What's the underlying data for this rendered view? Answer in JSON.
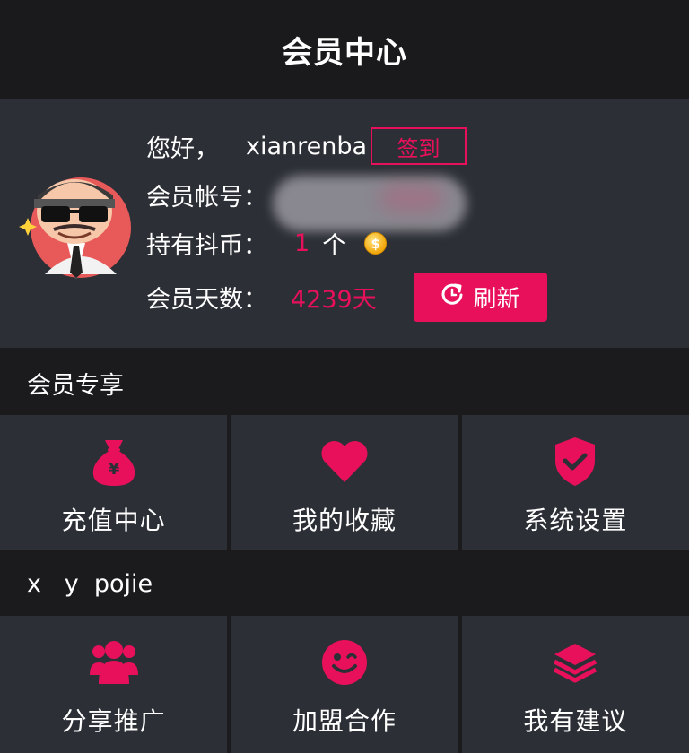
{
  "header": {
    "title": "会员中心"
  },
  "profile": {
    "greeting_label": "您好，",
    "username": "xianrenba",
    "checkin_label": "签到",
    "account_label": "会员帐号：",
    "coins_label": "持有抖币：",
    "coins_count": "1",
    "coins_unit": "个",
    "days_label": "会员天数：",
    "days_value": "4239天",
    "refresh_label": "刷新"
  },
  "sections": [
    {
      "title": "会员专享",
      "items": [
        {
          "label": "充值中心",
          "icon": "money-bag-icon"
        },
        {
          "label": "我的收藏",
          "icon": "heart-icon"
        },
        {
          "label": "系统设置",
          "icon": "shield-check-icon"
        }
      ]
    },
    {
      "title": "x   y  pojie",
      "items": [
        {
          "label": "分享推广",
          "icon": "users-group-icon"
        },
        {
          "label": "加盟合作",
          "icon": "wink-smiley-icon"
        },
        {
          "label": "我有建议",
          "icon": "layers-icon"
        }
      ]
    }
  ],
  "colors": {
    "accent": "#e8105a",
    "background": "#1b1b1d",
    "panel": "#2c2f36"
  }
}
